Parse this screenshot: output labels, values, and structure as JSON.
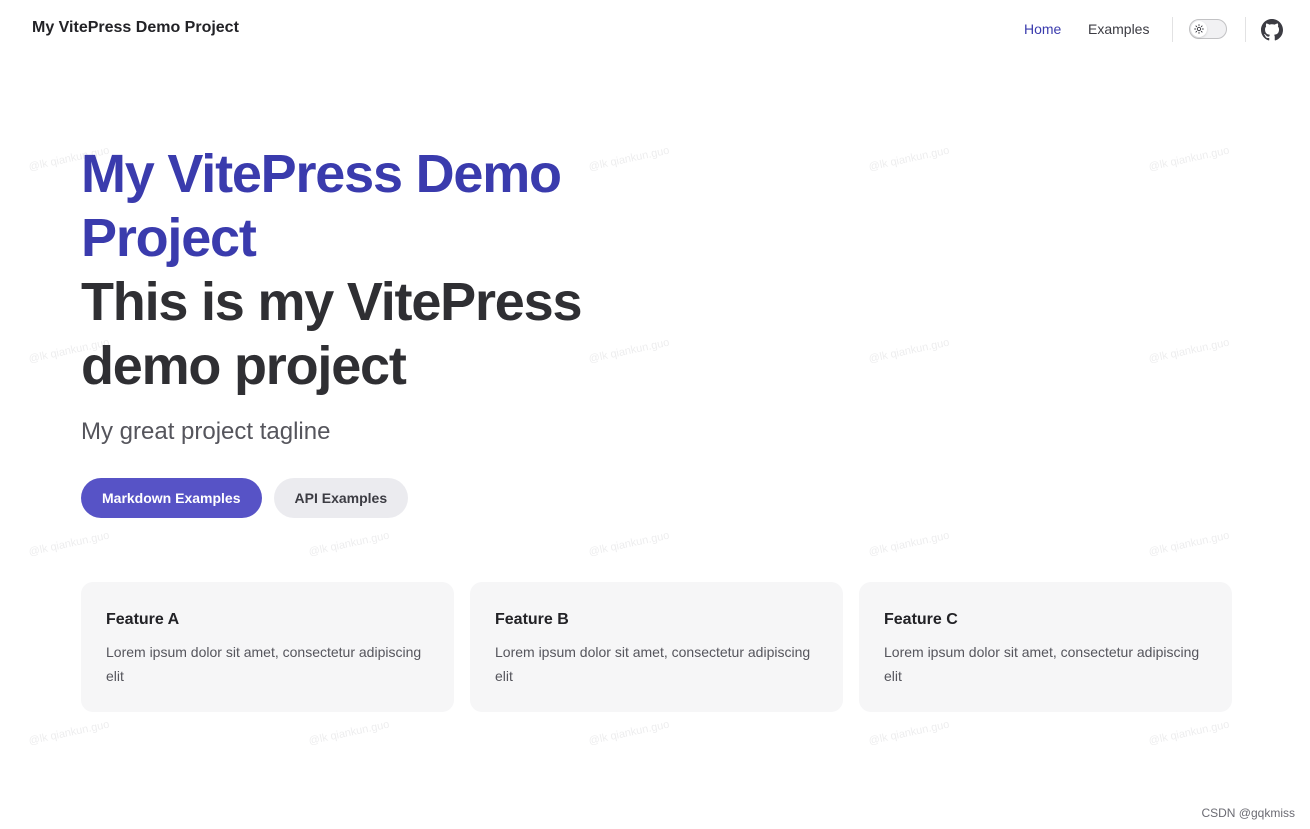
{
  "nav": {
    "title": "My VitePress Demo Project",
    "links": [
      {
        "label": "Home",
        "active": true
      },
      {
        "label": "Examples",
        "active": false
      }
    ],
    "theme_toggle": "sun-icon",
    "social": "github-icon"
  },
  "hero": {
    "name": "My VitePress Demo Project",
    "text": "This is my VitePress demo project",
    "tagline": "My great project tagline",
    "actions": [
      {
        "label": "Markdown Examples",
        "theme": "brand"
      },
      {
        "label": "API Examples",
        "theme": "alt"
      }
    ]
  },
  "features": [
    {
      "title": "Feature A",
      "details": "Lorem ipsum dolor sit amet, consectetur adipiscing elit"
    },
    {
      "title": "Feature B",
      "details": "Lorem ipsum dolor sit amet, consectetur adipiscing elit"
    },
    {
      "title": "Feature C",
      "details": "Lorem ipsum dolor sit amet, consectetur adipiscing elit"
    }
  ],
  "watermark": "@lk qiankun.guo",
  "footer_credit": "CSDN @gqkmiss",
  "colors": {
    "brand": "#3a3bad",
    "button_brand": "#5753c6",
    "button_alt": "#ebebef",
    "card_bg": "#f6f6f7"
  }
}
